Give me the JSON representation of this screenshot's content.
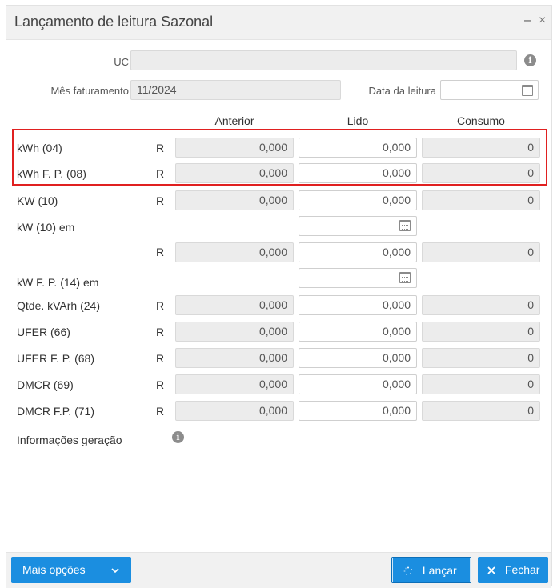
{
  "dialog": {
    "title": "Lançamento de leitura Sazonal",
    "minimize_glyph": "–",
    "close_glyph": "×"
  },
  "header_fields": {
    "uc_label": "UC",
    "uc_value": "",
    "mes_label": "Mês faturamento",
    "mes_value": "11/2024",
    "data_label": "Data da leitura",
    "data_value": ""
  },
  "columns": {
    "anterior": "Anterior",
    "lido": "Lido",
    "consumo": "Consumo"
  },
  "rows": [
    {
      "label": "kWh (04)",
      "r": "R",
      "anterior": "0,000",
      "lido": "0,000",
      "consumo": "0"
    },
    {
      "label": "kWh F. P. (08)",
      "r": "R",
      "anterior": "0,000",
      "lido": "0,000",
      "consumo": "0"
    },
    {
      "label": "KW (10)",
      "r": "R",
      "anterior": "0,000",
      "lido": "0,000",
      "consumo": "0"
    },
    {
      "label": "kW (10) em"
    },
    {
      "label": "",
      "r": "R",
      "anterior": "0,000",
      "lido": "0,000",
      "consumo": "0"
    },
    {
      "label": "kW F. P. (14) em"
    },
    {
      "label": "Qtde. kVArh (24)",
      "r": "R",
      "anterior": "0,000",
      "lido": "0,000",
      "consumo": "0"
    },
    {
      "label": "UFER (66)",
      "r": "R",
      "anterior": "0,000",
      "lido": "0,000",
      "consumo": "0"
    },
    {
      "label": "UFER F. P. (68)",
      "r": "R",
      "anterior": "0,000",
      "lido": "0,000",
      "consumo": "0"
    },
    {
      "label": "DMCR (69)",
      "r": "R",
      "anterior": "0,000",
      "lido": "0,000",
      "consumo": "0"
    },
    {
      "label": "DMCR F.P. (71)",
      "r": "R",
      "anterior": "0,000",
      "lido": "0,000",
      "consumo": "0"
    }
  ],
  "info_geracao_label": "Informações geração",
  "footer": {
    "mais_opcoes": "Mais opções",
    "lancar": "Lançar",
    "fechar": "Fechar"
  },
  "icons": {
    "info": "info-icon",
    "calendar": "calendar-icon",
    "chevron": "chevron-down-icon",
    "spinner": "spinner-icon",
    "close": "close-icon"
  },
  "colors": {
    "primary_button": "#1b8ee0",
    "highlight_border": "#e02020"
  }
}
